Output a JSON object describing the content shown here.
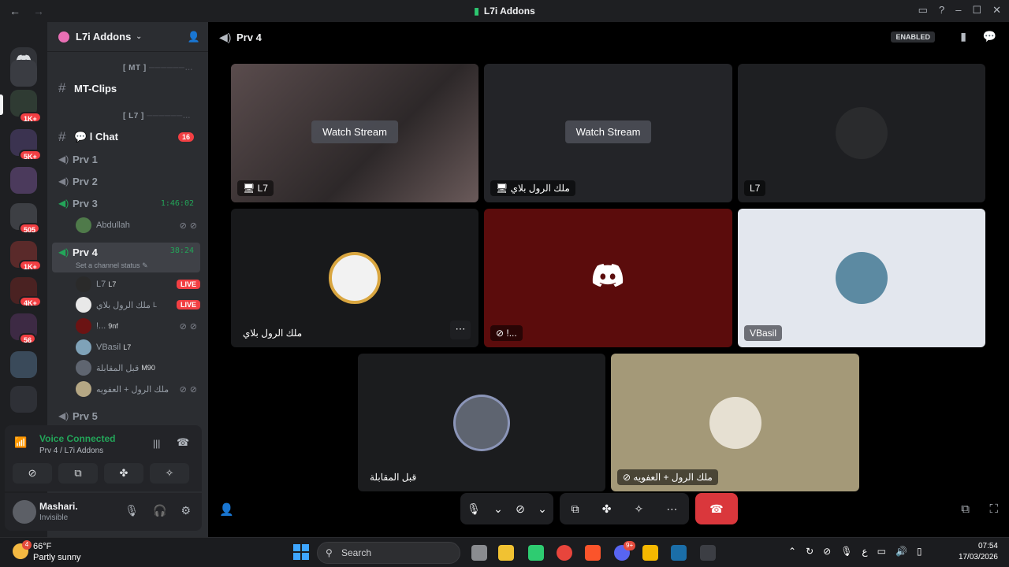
{
  "window": {
    "title": "L7i Addons",
    "back": "←",
    "forward": "→"
  },
  "server": {
    "name": "L7i Addons"
  },
  "categories": [
    {
      "label": "[ MT ]"
    },
    {
      "label": "[ L7 ]"
    }
  ],
  "channels": {
    "mt_clips": "MT-Clips",
    "chat": "💬 l Chat",
    "chat_badge": "16",
    "prv1": "Prv 1",
    "prv2": "Prv 2",
    "prv3": "Prv 3",
    "prv3_timer": "1:46:02",
    "prv3_member": "Abdullah",
    "prv4": "Prv 4",
    "prv4_timer": "38:24",
    "prv4_status": "Set a channel status",
    "prv5": "Prv 5"
  },
  "prv4_members": [
    {
      "name": "L7",
      "tag": "L7",
      "badge": "LIVE"
    },
    {
      "name": "ملك الرول بلاي",
      "tag": "L",
      "badge": "LIVE"
    },
    {
      "name": "!...",
      "tag": "9nf",
      "badge": ""
    },
    {
      "name": "VBasil",
      "tag": "L7",
      "badge": ""
    },
    {
      "name": "قبل المقابلة",
      "tag": "M90",
      "badge": ""
    },
    {
      "name": "ملك الرول + العفويه",
      "tag": "",
      "badge": ""
    }
  ],
  "guild_badges": [
    "1K+",
    "5K+",
    "505",
    "1K+",
    "4K+",
    "56"
  ],
  "voice": {
    "status": "Voice Connected",
    "location": "Prv 4 / L7i Addons"
  },
  "user": {
    "name": "Mashari.",
    "status": "Invisible"
  },
  "header": {
    "channel": "Prv 4",
    "enabled": "ENABLED"
  },
  "tiles": [
    {
      "label": "L7",
      "action": "Watch Stream"
    },
    {
      "label": "ملك الرول بلاي",
      "action": "Watch Stream"
    },
    {
      "label": "L7"
    },
    {
      "label": "ملك الرول بلاي"
    },
    {
      "label": "!..."
    },
    {
      "label": "VBasil"
    },
    {
      "label": "قبل المقابلة"
    },
    {
      "label": "ملك الرول + العفويه"
    }
  ],
  "taskbar": {
    "temp": "66°F",
    "weather": "Partly sunny",
    "search": "Search",
    "time": "07:54",
    "date": "17/03/2026",
    "lang": "ع",
    "discord_badge": "9+",
    "weather_badge": "4"
  }
}
